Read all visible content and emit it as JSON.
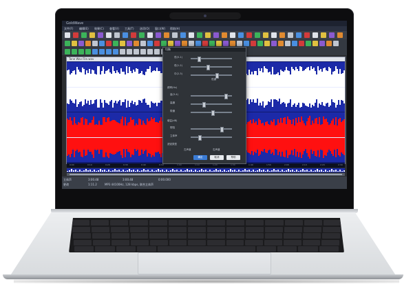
{
  "app": {
    "title": "GoldWave",
    "menu": [
      "文件(F)",
      "编辑(E)",
      "效果(C)",
      "查看(V)",
      "工具(T)",
      "选项(O)",
      "窗口(W)",
      "帮助(H)"
    ]
  },
  "wave": {
    "title": "Tone Wav File.wav",
    "ticks": [
      "0:00",
      "0:10",
      "0:20",
      "0:30",
      "0:40",
      "0:50",
      "1:00",
      "1:10",
      "1:20",
      "1:30",
      "1:40",
      "1:50",
      "2:00",
      "2:10",
      "2:20",
      "2:30"
    ]
  },
  "status": {
    "row1": [
      "立体声",
      "3:00.48",
      "3:00.48",
      "0:00.000"
    ],
    "row2": [
      "更改",
      "1:11.2",
      "MP3 44100Hz, 128 kbps, 联合立体声"
    ]
  },
  "dialog": {
    "title": "均衡",
    "section1": "频率(Hz)",
    "section2": "增益(dB)",
    "section3": "滤波类型",
    "labels": [
      "低(0-1)",
      "低(1-2)",
      "中(2-3)",
      "低通",
      "高(3-4)",
      "高通",
      "带通",
      "带阻",
      "立体声",
      "左声道",
      "右声道"
    ],
    "buttons": {
      "ok": "确定",
      "cancel": "取消",
      "help": "帮助"
    }
  },
  "colors": {
    "wave_top": "#ffffff",
    "wave_bottom": "#ff1010",
    "wave_bg": "#1c2aa8"
  }
}
